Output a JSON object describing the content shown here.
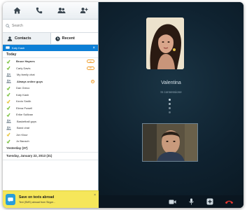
{
  "sidebar": {
    "toolbar": {
      "icons": [
        "home-icon",
        "phone-icon",
        "contacts-icon",
        "add-contact-icon"
      ]
    },
    "search": {
      "placeholder": "Search"
    },
    "tabs": [
      {
        "label": "Contacts",
        "icon": "contacts-icon",
        "active": true
      },
      {
        "label": "Recent",
        "icon": "recent-icon",
        "active": false
      }
    ],
    "selected": {
      "label": "Katy Kash"
    },
    "today": {
      "label": "Today"
    },
    "items": [
      {
        "name": "Bruce Haynes",
        "bold": true,
        "icon": "presence-online-icon",
        "badge": "(2)"
      },
      {
        "name": "Carly Davis",
        "bold": false,
        "icon": "presence-online-icon",
        "badge": "(3)"
      },
      {
        "name": "My family chat",
        "bold": false,
        "icon": "group-chat-icon",
        "badge": ""
      },
      {
        "name": "Always online guys",
        "bold": true,
        "icon": "group-chat-icon",
        "badge": "2"
      },
      {
        "name": "Dan Greco",
        "bold": false,
        "icon": "presence-online-icon",
        "badge": ""
      },
      {
        "name": "Katy Kash",
        "bold": false,
        "icon": "presence-online-icon",
        "badge": ""
      },
      {
        "name": "Kevin Smith",
        "bold": false,
        "icon": "presence-offline-icon",
        "badge": ""
      },
      {
        "name": "Elena Powell",
        "bold": false,
        "icon": "presence-online-icon",
        "badge": ""
      },
      {
        "name": "Erike Sullivan",
        "bold": false,
        "icon": "presence-online-icon",
        "badge": ""
      },
      {
        "name": "Basketball guys",
        "bold": false,
        "icon": "group-chat-icon",
        "badge": ""
      },
      {
        "name": "Band chat",
        "bold": false,
        "icon": "group-chat-icon",
        "badge": ""
      },
      {
        "name": "Jon Kisur",
        "bold": false,
        "icon": "presence-offline-icon",
        "badge": ""
      },
      {
        "name": "Jo Bausch",
        "bold": false,
        "icon": "presence-online-icon",
        "badge": ""
      }
    ],
    "yesterday": {
      "label": "Yesterday (37)"
    },
    "older": {
      "label": "Tuesday, January 22, 2013 (31)"
    },
    "promo": {
      "title": "Save on texts abroad",
      "subtitle": "Text (SMS) abroad from Skype...",
      "close": "×"
    }
  },
  "call": {
    "caller_name": "Valentina",
    "status": "In connessione",
    "controls": [
      "video-icon",
      "microphone-icon",
      "add-icon",
      "hang-up-icon"
    ]
  },
  "colors": {
    "accent": "#0c7fd6",
    "call_background": "#0f2230",
    "promo_background": "#f6e65a",
    "presence_online": "#7cc242",
    "hang_up": "#e8372f"
  }
}
